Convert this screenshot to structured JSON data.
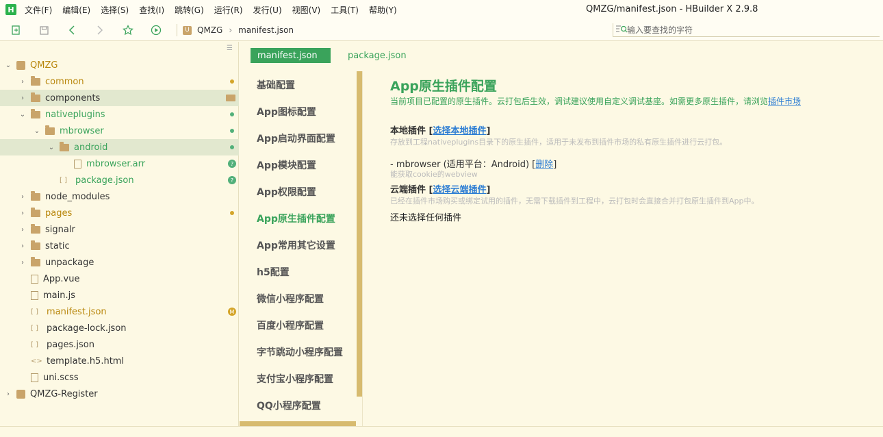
{
  "app": {
    "logo": "H",
    "window_title": "QMZG/manifest.json - HBuilder X 2.9.8"
  },
  "menu": [
    "文件(F)",
    "编辑(E)",
    "选择(S)",
    "查找(I)",
    "跳转(G)",
    "运行(R)",
    "发行(U)",
    "视图(V)",
    "工具(T)",
    "帮助(Y)"
  ],
  "toolbar": {
    "breadcrumb": [
      "QMZG",
      "manifest.json"
    ],
    "search_placeholder": "输入要查找的字符"
  },
  "tree": [
    {
      "label": "QMZG",
      "kind": "project",
      "arrow": "open",
      "depth": 0,
      "status": "mod"
    },
    {
      "label": "common",
      "kind": "folder",
      "arrow": "closed",
      "depth": 1,
      "status": "mod",
      "marker": "orange"
    },
    {
      "label": "components",
      "kind": "folder",
      "arrow": "closed",
      "depth": 1,
      "status": "normal",
      "marker": "folderm",
      "selected": true
    },
    {
      "label": "nativeplugins",
      "kind": "folder",
      "arrow": "open",
      "depth": 1,
      "status": "new",
      "marker": "green"
    },
    {
      "label": "mbrowser",
      "kind": "folder",
      "arrow": "open",
      "depth": 2,
      "status": "new",
      "marker": "green"
    },
    {
      "label": "android",
      "kind": "folder-open",
      "arrow": "open",
      "depth": 3,
      "status": "new",
      "marker": "green",
      "selected": true
    },
    {
      "label": "mbrowser.arr",
      "kind": "file",
      "arrow": "",
      "depth": 4,
      "status": "new",
      "marker": "q"
    },
    {
      "label": "package.json",
      "kind": "json",
      "arrow": "",
      "depth": 3,
      "status": "new",
      "marker": "q"
    },
    {
      "label": "node_modules",
      "kind": "folder",
      "arrow": "closed",
      "depth": 1,
      "status": "normal"
    },
    {
      "label": "pages",
      "kind": "folder",
      "arrow": "closed",
      "depth": 1,
      "status": "mod",
      "marker": "orange"
    },
    {
      "label": "signalr",
      "kind": "folder",
      "arrow": "closed",
      "depth": 1,
      "status": "normal"
    },
    {
      "label": "static",
      "kind": "folder",
      "arrow": "closed",
      "depth": 1,
      "status": "normal"
    },
    {
      "label": "unpackage",
      "kind": "folder",
      "arrow": "closed",
      "depth": 1,
      "status": "normal"
    },
    {
      "label": "App.vue",
      "kind": "file",
      "arrow": "",
      "depth": 1,
      "status": "normal"
    },
    {
      "label": "main.js",
      "kind": "file",
      "arrow": "",
      "depth": 1,
      "status": "normal"
    },
    {
      "label": "manifest.json",
      "kind": "json",
      "arrow": "",
      "depth": 1,
      "status": "mod",
      "marker": "m"
    },
    {
      "label": "package-lock.json",
      "kind": "json",
      "arrow": "",
      "depth": 1,
      "status": "normal"
    },
    {
      "label": "pages.json",
      "kind": "json",
      "arrow": "",
      "depth": 1,
      "status": "normal"
    },
    {
      "label": "template.h5.html",
      "kind": "html",
      "arrow": "",
      "depth": 1,
      "status": "normal"
    },
    {
      "label": "uni.scss",
      "kind": "file",
      "arrow": "",
      "depth": 1,
      "status": "normal"
    },
    {
      "label": "QMZG-Register",
      "kind": "project",
      "arrow": "closed",
      "depth": 0,
      "status": "normal"
    }
  ],
  "tabs": {
    "active": "manifest.json",
    "other": "package.json"
  },
  "config_nav": [
    {
      "label": "基础配置",
      "active": false
    },
    {
      "label": "App图标配置",
      "active": false
    },
    {
      "label": "App启动界面配置",
      "active": false
    },
    {
      "label": "App模块配置",
      "active": false
    },
    {
      "label": "App权限配置",
      "active": false
    },
    {
      "label": "App原生插件配置",
      "active": true
    },
    {
      "label": "App常用其它设置",
      "active": false
    },
    {
      "label": "h5配置",
      "active": false
    },
    {
      "label": "微信小程序配置",
      "active": false
    },
    {
      "label": "百度小程序配置",
      "active": false
    },
    {
      "label": "字节跳动小程序配置",
      "active": false
    },
    {
      "label": "支付宝小程序配置",
      "active": false
    },
    {
      "label": "QQ小程序配置",
      "active": false
    }
  ],
  "content": {
    "title": "App原生插件配置",
    "desc": "当前项目已配置的原生插件。云打包后生效，调试建议使用自定义调试基座。如需更多原生插件，请浏览",
    "desc_link": "插件市场",
    "local_title": "本地插件",
    "local_link": "选择本地插件",
    "local_hint": "存放到工程nativeplugins目录下的原生插件，适用于未发布到插件市场的私有原生插件进行云打包。",
    "local_plugin": "- mbrowser (适用平台：Android)",
    "local_plugin_delete": "删除",
    "local_plugin_desc": "能获取cookie的webview",
    "cloud_title": "云端插件",
    "cloud_link": "选择云端插件",
    "cloud_hint": "已经在插件市场购买或绑定试用的插件，无需下载插件到工程中，云打包时会直接合并打包原生插件到App中。",
    "none_selected": "还未选择任何插件"
  },
  "colors": {
    "accent": "#3aa35b",
    "background": "#fdf9e4",
    "link": "#2b7cd3",
    "modified": "#b8860b"
  }
}
